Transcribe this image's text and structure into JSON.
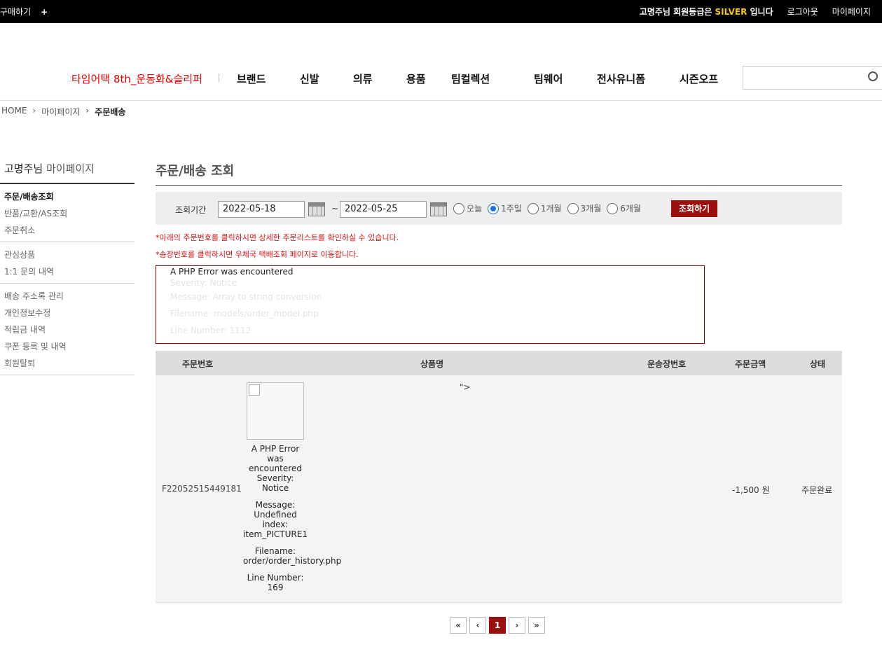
{
  "topbar": {
    "buy": "구매하기",
    "plus": "+",
    "greet_prefix": "고명주님 회원등급은",
    "grade": "SILVER",
    "greet_suffix": "입니다",
    "logout": "로그아웃",
    "mypage": "마이페이지"
  },
  "gnb": {
    "promo": "타임어택 8th_운동화&슬리퍼",
    "menu": [
      "브랜드",
      "신발",
      "의류",
      "용품",
      "팀컬렉션",
      "팀웨어",
      "전사유니폼",
      "시즌오프"
    ],
    "search_placeholder": ""
  },
  "breadcrumb": [
    "HOME",
    "마이페이지",
    "주문배송"
  ],
  "sidebar": {
    "title_name": "고명주님",
    "title_sub": "마이페이지",
    "groups": [
      [
        "주문/배송조회",
        "반품/교환/AS조회",
        "주문취소"
      ],
      [
        "관심상품",
        "1:1 문의 내역"
      ],
      [
        "배송 주소록 관리",
        "개인정보수정",
        "적립금 내역",
        "쿠폰 등록 및 내역",
        "회원탈퇴"
      ]
    ]
  },
  "main": {
    "title": "주문/배송 조회",
    "filter": {
      "label": "조회기간",
      "start": "2022-05-18",
      "tilde": "~",
      "end": "2022-05-25",
      "ranges": [
        "오늘",
        "1주일",
        "1개월",
        "3개월",
        "6개월"
      ],
      "selected": "1주일",
      "button": "조회하기"
    },
    "notices": [
      "*아래의 주문번호를 클릭하시면 상세한 주문리스트를 확인하실 수 있습니다.",
      "*송장번호를 클릭하시면 우체국 택배조회 페이지로 이동합니다."
    ],
    "error": {
      "head": "A PHP Error was encountered",
      "lines": [
        "Severity: Notice",
        "Message: Array to string conversion",
        "Filename: models/order_model.php",
        "Line Number: 1112"
      ]
    },
    "table": {
      "headers": [
        "주문번호",
        "상품명",
        "운송장번호",
        "주문금액",
        "상태"
      ],
      "row": {
        "order_no": "F22052515449181",
        "stray": "\">",
        "product_error": [
          "A PHP Error was encountered Severity: Notice",
          "Message: Undefined index: item_PICTURE1",
          "Filename: order/order_history.php",
          "Line Number: 169"
        ],
        "amount": "-1,500 원",
        "status": "주문완료"
      }
    },
    "pager": [
      "«",
      "‹",
      "1",
      "›",
      "»"
    ]
  }
}
